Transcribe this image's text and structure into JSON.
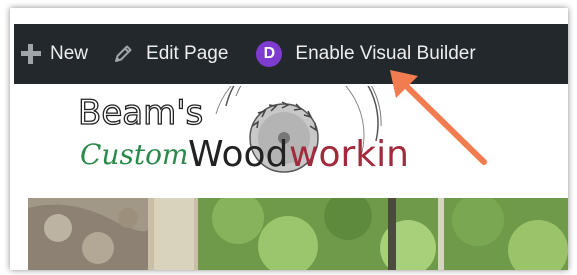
{
  "admin_bar": {
    "new_label": "New",
    "edit_page_label": "Edit Page",
    "divi_letter": "D",
    "visual_builder_label": "Enable Visual Builder"
  },
  "logo": {
    "line1": "Beam's",
    "line2": "Custom",
    "line3_part1": "Wood",
    "line3_part2": "working",
    "colors": {
      "dark": "#222222",
      "green": "#2a8a4a",
      "red": "#a12a3c"
    }
  },
  "colors": {
    "admin_bar": "#23282d",
    "divi_purple": "#7e3bd0",
    "annotation_arrow": "#f07c4f"
  },
  "icons": {
    "plus": "plus-icon",
    "pencil": "pencil-icon",
    "divi": "divi-logo-icon",
    "saw_blade": "saw-blade-icon"
  }
}
